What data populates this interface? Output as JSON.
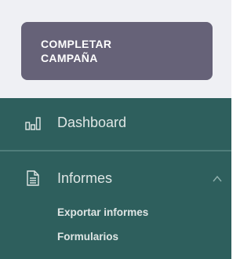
{
  "cta": {
    "label": "COMPLETAR CAMPAÑA"
  },
  "nav": {
    "dashboard": {
      "label": "Dashboard",
      "icon": "bar-chart-icon"
    },
    "informes": {
      "label": "Informes",
      "icon": "document-icon",
      "expanded": true,
      "subitems": [
        {
          "label": "Exportar informes"
        },
        {
          "label": "Formularios"
        }
      ]
    }
  },
  "colors": {
    "cta_background": "#666278",
    "top_background": "#eff0f4",
    "sidebar_background": "#2e5f5d",
    "sidebar_text": "#dfe6e5"
  }
}
